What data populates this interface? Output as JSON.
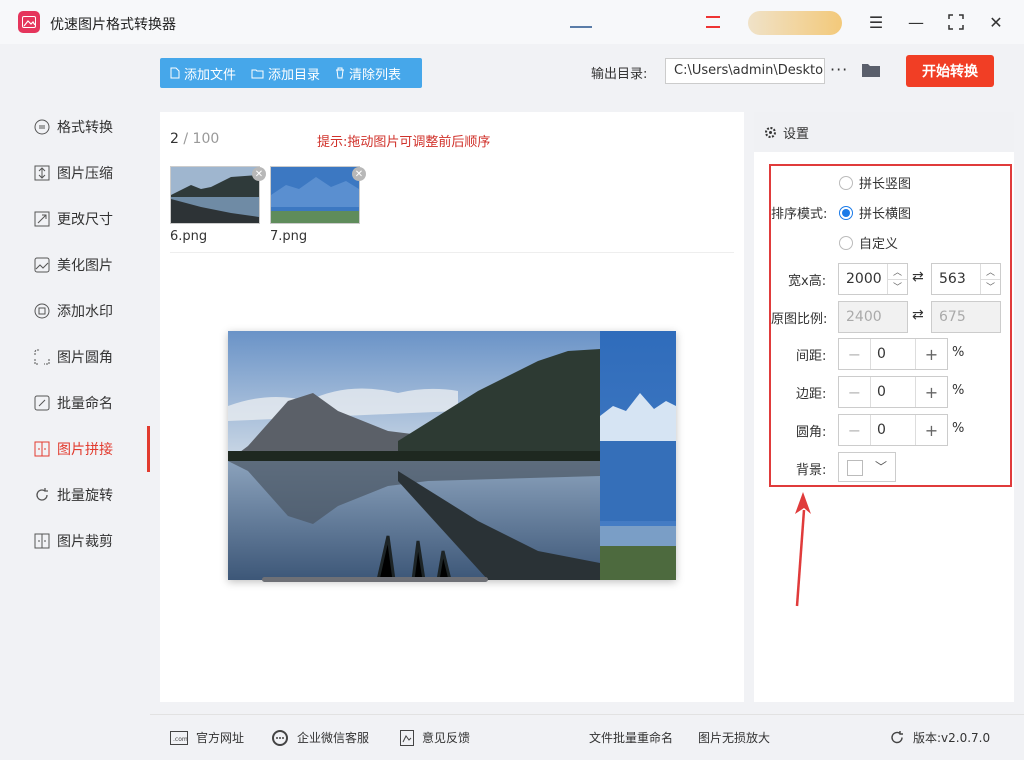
{
  "app": {
    "title": "优速图片格式转换器"
  },
  "sidebar": {
    "items": [
      {
        "label": "格式转换",
        "icon": "format-convert-icon"
      },
      {
        "label": "图片压缩",
        "icon": "compress-icon"
      },
      {
        "label": "更改尺寸",
        "icon": "resize-icon"
      },
      {
        "label": "美化图片",
        "icon": "beautify-icon"
      },
      {
        "label": "添加水印",
        "icon": "watermark-icon"
      },
      {
        "label": "图片圆角",
        "icon": "rounded-corner-icon"
      },
      {
        "label": "批量命名",
        "icon": "rename-icon"
      },
      {
        "label": "图片拼接",
        "icon": "stitch-icon",
        "active": true
      },
      {
        "label": "批量旋转",
        "icon": "rotate-icon"
      },
      {
        "label": "图片裁剪",
        "icon": "crop-icon"
      }
    ]
  },
  "toolbar": {
    "add_file": "添加文件",
    "add_folder": "添加目录",
    "clear_list": "清除列表",
    "output_label": "输出目录:",
    "output_path": "C:\\Users\\admin\\Desktop",
    "more": "···",
    "start": "开始转换"
  },
  "list": {
    "count": "2",
    "total": "/ 100",
    "hint": "提示:拖动图片可调整前后顺序",
    "files": [
      {
        "name": "6.png"
      },
      {
        "name": "7.png"
      }
    ]
  },
  "settings": {
    "title": "设置",
    "order_mode_label": "排序模式:",
    "modes": [
      "拼长竖图",
      "拼长横图",
      "自定义"
    ],
    "selected_mode": "拼长横图",
    "size_label": "宽x高:",
    "width": "2000",
    "height": "563",
    "ratio_label": "原图比例:",
    "ratio_w": "2400",
    "ratio_h": "675",
    "spacing_label": "间距:",
    "spacing": "0",
    "margin_label": "边距:",
    "margin": "0",
    "corner_label": "圆角:",
    "corner": "0",
    "pct": "%",
    "bg_label": "背景:",
    "bg_color": "#ffffff"
  },
  "footer": {
    "website": "官方网址",
    "wechat": "企业微信客服",
    "feedback": "意见反馈",
    "batch_rename": "文件批量重命名",
    "lossless": "图片无损放大",
    "version": "版本:v2.0.7.0"
  },
  "colors": {
    "accent": "#e23b2e",
    "primary": "#46a7ea",
    "start": "#f13e25",
    "annotation": "#e03b3b"
  }
}
